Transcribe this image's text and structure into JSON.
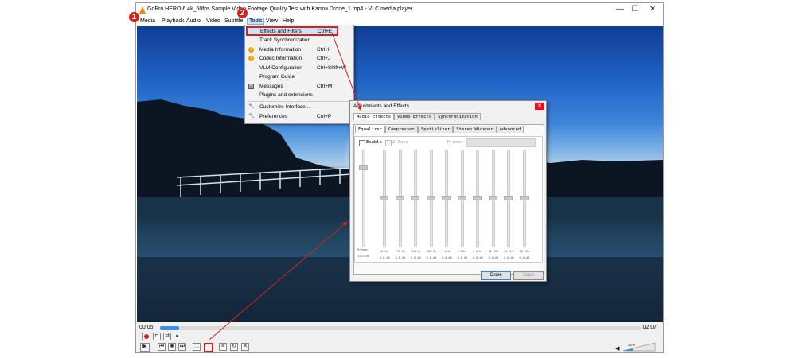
{
  "window": {
    "title": "GoPro HERO 6 4k_60fps Sample  Video Footage Quality Test with Karma Drone_1.mp4 - VLC media player",
    "controls": {
      "minimize": "—",
      "maximize": "☐",
      "close": "✕"
    }
  },
  "menubar": {
    "items": [
      "Media",
      "Playback",
      "Audio",
      "Video",
      "Subtitle",
      "Tools",
      "View",
      "Help"
    ]
  },
  "tools_menu": {
    "items": [
      {
        "label": "Effects and Filters",
        "shortcut": "Ctrl+E",
        "icon": "equalizer-icon"
      },
      {
        "label": "Track Synchronization",
        "shortcut": "",
        "icon": ""
      },
      {
        "label": "Media Information",
        "shortcut": "Ctrl+I",
        "icon": "info-icon"
      },
      {
        "label": "Codec Information",
        "shortcut": "Ctrl+J",
        "icon": "info-icon"
      },
      {
        "label": "VLM Configuration",
        "shortcut": "Ctrl+Shift+W",
        "icon": ""
      },
      {
        "label": "Program Guide",
        "shortcut": "",
        "icon": ""
      },
      {
        "label": "Messages",
        "shortcut": "Ctrl+M",
        "icon": "messages-icon"
      },
      {
        "label": "Plugins and extensions",
        "shortcut": "",
        "icon": ""
      },
      {
        "label": "Customize Interface...",
        "shortcut": "",
        "icon": "wrench-icon"
      },
      {
        "label": "Preferences",
        "shortcut": "Ctrl+P",
        "icon": "wrench-icon"
      }
    ]
  },
  "dialog": {
    "title": "Adjustments and Effects",
    "close": "✕",
    "tabs": [
      "Audio Effects",
      "Video Effects",
      "Synchronization"
    ],
    "subtabs": [
      "Equalizer",
      "Compressor",
      "Spatializer",
      "Stereo Widener",
      "Advanced"
    ],
    "enable_label": "Enable",
    "two_pass_label": "2 Pass",
    "preset_label": "Preset",
    "preamp_label": "Preamp",
    "preamp_value": "12.0 dB",
    "bands": [
      "60 Hz",
      "170 Hz",
      "310 Hz",
      "600 Hz",
      "1 KHz",
      "3 KHz",
      "6 KHz",
      "12 KHz",
      "14 KHz",
      "16 KHz"
    ],
    "band_value": "0.0 dB",
    "close_button": "Close",
    "save_button": "Save"
  },
  "player": {
    "elapsed": "00:05",
    "total": "02:07",
    "progress_fraction": 0.04,
    "volume_percent": "30%"
  },
  "callouts": [
    "1",
    "2"
  ],
  "colors": {
    "highlight": "#d6201a",
    "seek_fill": "#3d8fe0",
    "vlc_orange": "#f08a00"
  }
}
